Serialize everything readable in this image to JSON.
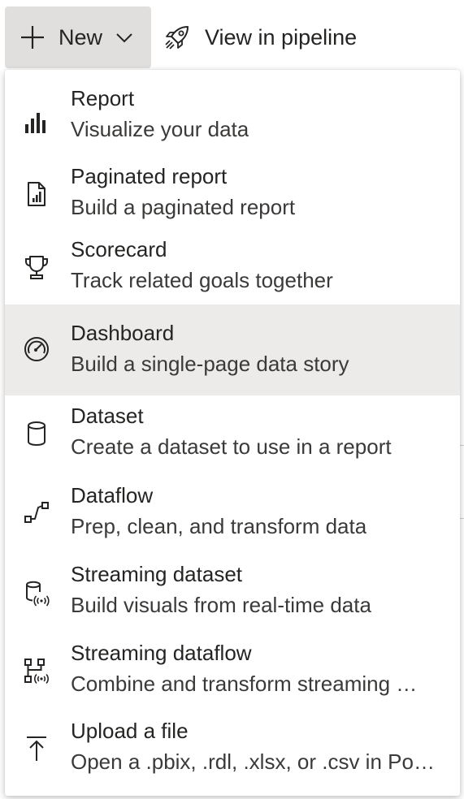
{
  "toolbar": {
    "new_label": "New",
    "pipeline_label": "View in pipeline"
  },
  "menu": {
    "items": [
      {
        "title": "Report",
        "desc": "Visualize your data",
        "icon": "bar-chart-icon"
      },
      {
        "title": "Paginated report",
        "desc": "Build a paginated report",
        "icon": "paginated-report-icon"
      },
      {
        "title": "Scorecard",
        "desc": "Track related goals together",
        "icon": "trophy-icon"
      },
      {
        "title": "Dashboard",
        "desc": "Build a single-page data story",
        "icon": "gauge-icon"
      },
      {
        "title": "Dataset",
        "desc": "Create a dataset to use in a report",
        "icon": "database-icon"
      },
      {
        "title": "Dataflow",
        "desc": "Prep, clean, and transform data",
        "icon": "dataflow-icon"
      },
      {
        "title": "Streaming dataset",
        "desc": "Build visuals from real-time data",
        "icon": "streaming-database-icon"
      },
      {
        "title": "Streaming dataflow",
        "desc": "Combine and transform streaming …",
        "icon": "streaming-dataflow-icon"
      },
      {
        "title": "Upload a file",
        "desc": "Open a .pbix, .rdl, .xlsx, or .csv in Po…",
        "icon": "upload-icon"
      }
    ],
    "selected_index": 3
  },
  "colors": {
    "new_button_bg": "#e1dfdd",
    "selected_bg": "#edebe9",
    "text": "#252423"
  }
}
